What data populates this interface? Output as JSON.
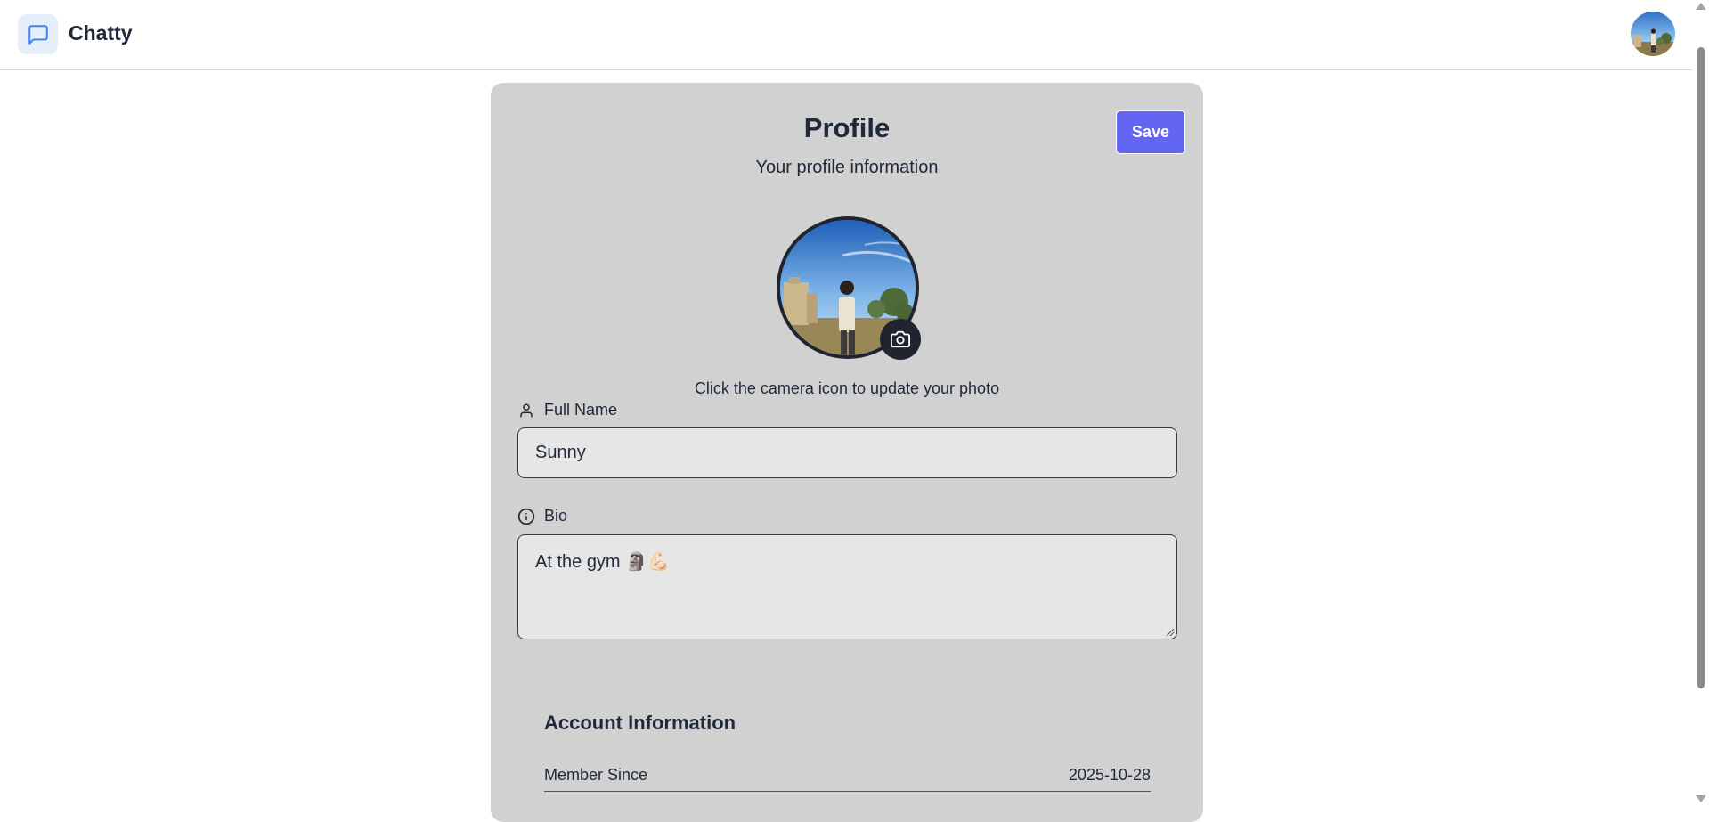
{
  "app": {
    "name": "Chatty",
    "accent_color": "#6366f1",
    "logo_icon": "message-square-icon"
  },
  "profile": {
    "title": "Profile",
    "subtitle": "Your profile information",
    "save_label": "Save",
    "photo_hint": "Click the camera icon to update your photo",
    "full_name": {
      "label": "Full Name",
      "value": "Sunny",
      "icon": "user-icon"
    },
    "bio": {
      "label": "Bio",
      "value": "At the gym 🗿💪🏻",
      "icon": "info-icon"
    }
  },
  "account": {
    "title": "Account Information",
    "rows": [
      {
        "label": "Member Since",
        "value": "2025-10-28"
      }
    ]
  }
}
